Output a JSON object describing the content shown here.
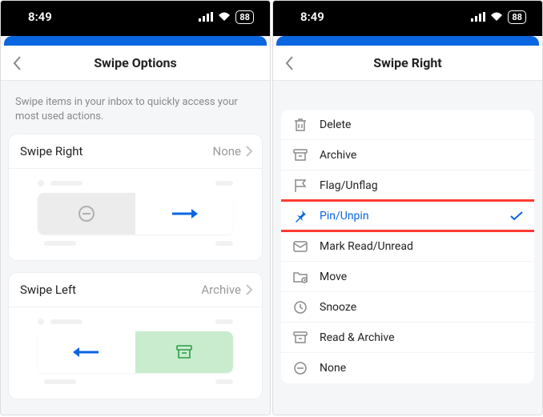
{
  "status": {
    "time": "8:49",
    "battery": "88"
  },
  "left": {
    "title": "Swipe Options",
    "subtitle": "Swipe items in your inbox to quickly access your most used actions.",
    "swipe_right": {
      "label": "Swipe Right",
      "value": "None"
    },
    "swipe_left": {
      "label": "Swipe Left",
      "value": "Archive"
    }
  },
  "right": {
    "title": "Swipe Right",
    "options": [
      {
        "label": "Delete"
      },
      {
        "label": "Archive"
      },
      {
        "label": "Flag/Unflag"
      },
      {
        "label": "Pin/Unpin"
      },
      {
        "label": "Mark Read/Unread"
      },
      {
        "label": "Move"
      },
      {
        "label": "Snooze"
      },
      {
        "label": "Read & Archive"
      },
      {
        "label": "None"
      }
    ],
    "selected_index": 3
  }
}
